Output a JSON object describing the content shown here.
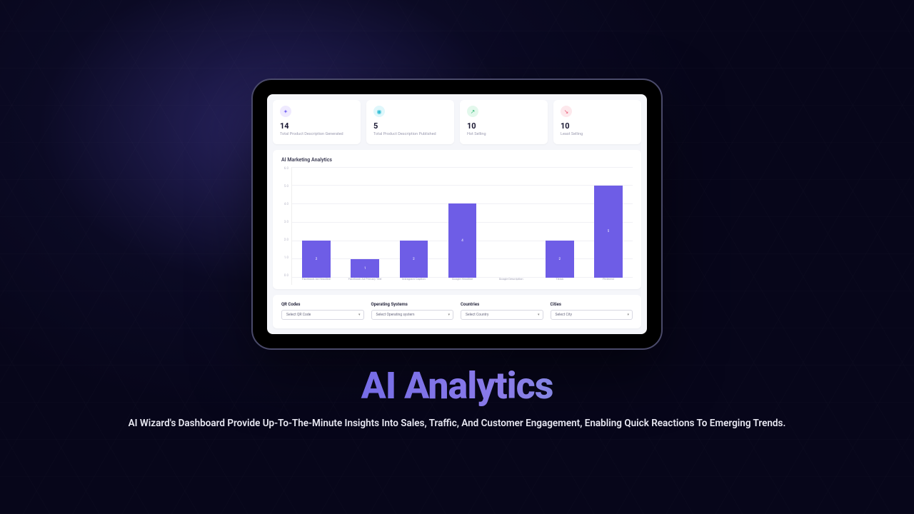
{
  "hero": {
    "title": "AI Analytics",
    "subtitle": "AI Wizard's Dashboard Provide Up-To-The-Minute Insights Into Sales, Traffic, And Customer Engagement, Enabling Quick Reactions To Emerging Trends."
  },
  "stats": [
    {
      "value": "14",
      "label": "Total Product Description Generated",
      "icon": "sparkle-icon",
      "cls": "ic-purple",
      "glyph": "✦"
    },
    {
      "value": "5",
      "label": "Total Product Description Published",
      "icon": "badge-icon",
      "cls": "ic-cyan",
      "glyph": "◉"
    },
    {
      "value": "10",
      "label": "Hot Selling",
      "icon": "trend-up-icon",
      "cls": "ic-green",
      "glyph": "↗"
    },
    {
      "value": "10",
      "label": "Least Selling",
      "icon": "trend-down-icon",
      "cls": "ic-pink",
      "glyph": "↘"
    }
  ],
  "chart_title": "AI Marketing Analytics",
  "chart_data": {
    "type": "bar",
    "title": "AI Marketing Analytics",
    "xlabel": "",
    "ylabel": "",
    "ylim": [
      0,
      6
    ],
    "y_ticks": [
      "6.0",
      "5.0",
      "4.0",
      "3.0",
      "2.0",
      "1.0",
      "0.0"
    ],
    "categories": [
      "Facebook Ad Headline",
      "Facebook Ad Primary Text",
      "Instagram Caption",
      "Google Headline",
      "Google Description",
      "Tiktok",
      "Pinterest"
    ],
    "values": [
      2,
      1,
      2,
      4,
      0,
      2,
      5
    ],
    "bar_color": "#6e5de6"
  },
  "filters": [
    {
      "label": "QR Codes",
      "placeholder": "Select QR Code"
    },
    {
      "label": "Operating Systems",
      "placeholder": "Select Operating system"
    },
    {
      "label": "Countries",
      "placeholder": "Select Country"
    },
    {
      "label": "Cities",
      "placeholder": "Select City"
    }
  ]
}
